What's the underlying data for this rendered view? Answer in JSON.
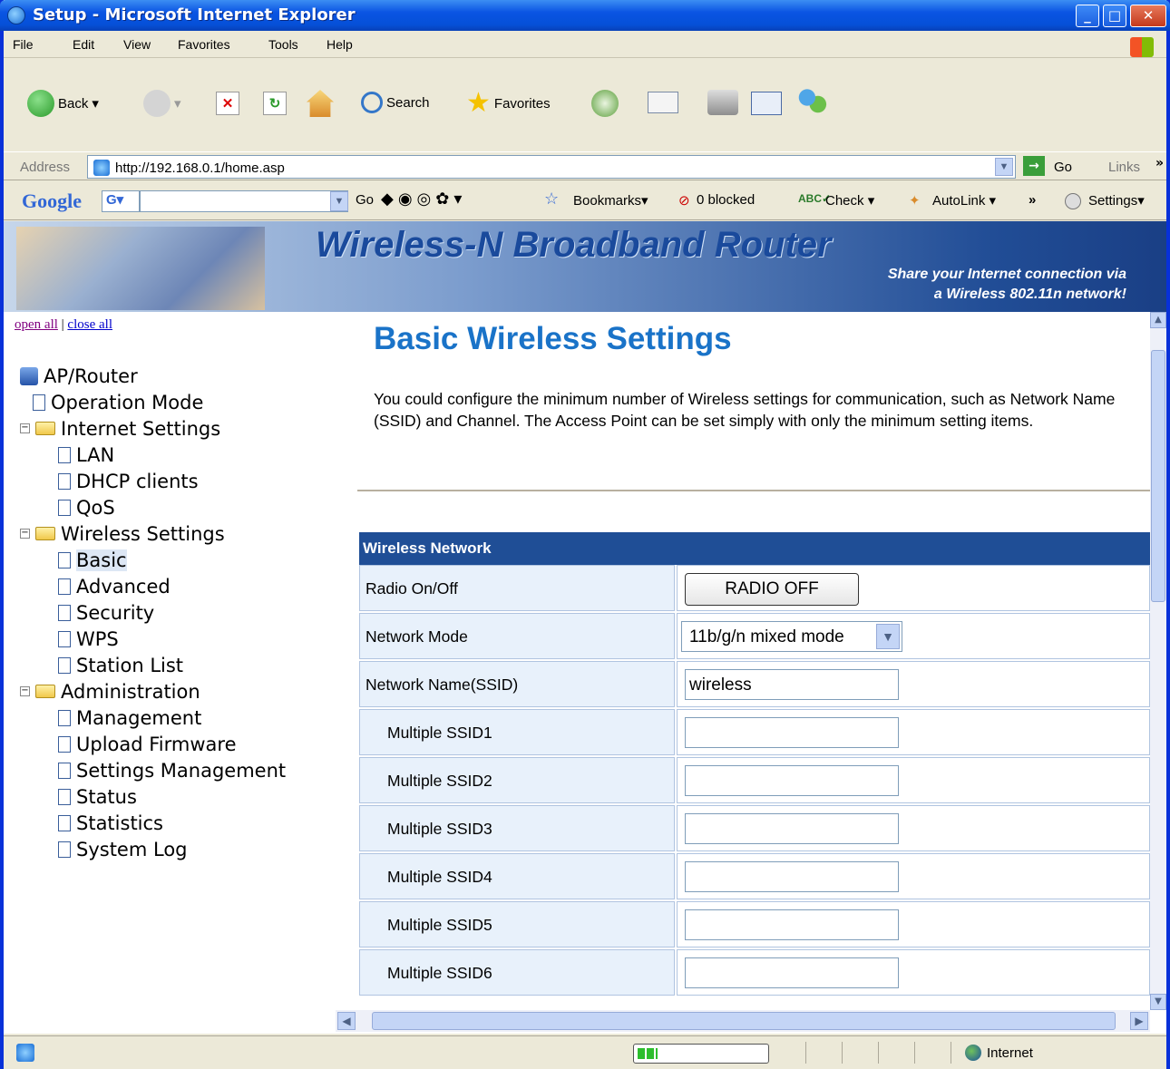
{
  "window": {
    "title": "Setup - Microsoft Internet Explorer",
    "min": "_",
    "max": "□",
    "close": "✕"
  },
  "menu": [
    "File",
    "Edit",
    "View",
    "Favorites",
    "Tools",
    "Help"
  ],
  "toolbar": {
    "back": "Back",
    "search": "Search",
    "favorites": "Favorites"
  },
  "address": {
    "label": "Address",
    "url": "http://192.168.0.1/home.asp",
    "go": "Go",
    "links": "Links",
    "chevrons": "»"
  },
  "googlebar": {
    "brand": "Google",
    "g_logo": "G",
    "go": "Go",
    "bookmarks": "Bookmarks",
    "blocked": "0 blocked",
    "check": "Check",
    "autolink": "AutoLink",
    "chevrons": "»",
    "settings": "Settings"
  },
  "banner": {
    "title": "Wireless-N Broadband Router",
    "sub1": "Share your Internet connection via",
    "sub2": "a Wireless 802.11n network!"
  },
  "nav": {
    "open_all": "open all",
    "separator": "|",
    "close_all": "close all",
    "root": "AP/Router",
    "items": [
      {
        "label": "Operation Mode",
        "level": 1,
        "type": "page"
      },
      {
        "label": "Internet Settings",
        "level": 1,
        "type": "folder"
      },
      {
        "label": "LAN",
        "level": 2,
        "type": "page"
      },
      {
        "label": "DHCP clients",
        "level": 2,
        "type": "page"
      },
      {
        "label": "QoS",
        "level": 2,
        "type": "page"
      },
      {
        "label": "Wireless Settings",
        "level": 1,
        "type": "folder"
      },
      {
        "label": "Basic",
        "level": 2,
        "type": "page",
        "selected": true
      },
      {
        "label": "Advanced",
        "level": 2,
        "type": "page"
      },
      {
        "label": "Security",
        "level": 2,
        "type": "page"
      },
      {
        "label": "WPS",
        "level": 2,
        "type": "page"
      },
      {
        "label": "Station List",
        "level": 2,
        "type": "page"
      },
      {
        "label": "Administration",
        "level": 1,
        "type": "folder"
      },
      {
        "label": "Management",
        "level": 2,
        "type": "page"
      },
      {
        "label": "Upload Firmware",
        "level": 2,
        "type": "page"
      },
      {
        "label": "Settings Management",
        "level": 2,
        "type": "page"
      },
      {
        "label": "Status",
        "level": 2,
        "type": "page"
      },
      {
        "label": "Statistics",
        "level": 2,
        "type": "page"
      },
      {
        "label": "System Log",
        "level": 2,
        "type": "page"
      }
    ]
  },
  "main": {
    "heading": "Basic Wireless Settings",
    "description": "You could configure the minimum number of Wireless settings for communication, such as Network Name (SSID) and Channel. The Access Point can be set simply with only the minimum setting items.",
    "table_header": "Wireless Network",
    "rows": [
      {
        "label": "Radio On/Off",
        "control": "button",
        "value": "RADIO OFF"
      },
      {
        "label": "Network Mode",
        "control": "select",
        "value": "11b/g/n mixed mode"
      },
      {
        "label": "Network Name(SSID)",
        "control": "input",
        "value": "wireless"
      },
      {
        "label": "Multiple SSID1",
        "control": "input",
        "value": "",
        "indent": true
      },
      {
        "label": "Multiple SSID2",
        "control": "input",
        "value": "",
        "indent": true
      },
      {
        "label": "Multiple SSID3",
        "control": "input",
        "value": "",
        "indent": true
      },
      {
        "label": "Multiple SSID4",
        "control": "input",
        "value": "",
        "indent": true
      },
      {
        "label": "Multiple SSID5",
        "control": "input",
        "value": "",
        "indent": true
      },
      {
        "label": "Multiple SSID6",
        "control": "input",
        "value": "",
        "indent": true
      }
    ]
  },
  "status": {
    "zone": "Internet"
  },
  "colors": {
    "heading": "#1a73c8",
    "table_header": "#1f4e96",
    "label_bg": "#e8f1fb",
    "title_bar": "#0a54e3"
  }
}
